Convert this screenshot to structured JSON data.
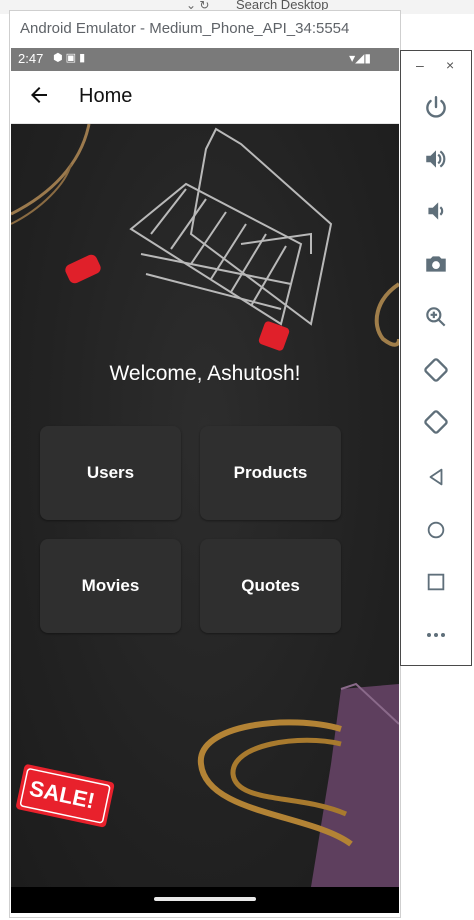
{
  "desktop": {
    "search_text": "Search Desktop",
    "icons": "⌄ ↻"
  },
  "emulator": {
    "title": "Android Emulator - Medium_Phone_API_34:5554"
  },
  "status_bar": {
    "time": "2:47",
    "left_icons": "⬢ ▣ ▮",
    "right_icons": "▾◢▮"
  },
  "app_bar": {
    "title": "Home"
  },
  "main": {
    "welcome": "Welcome, Ashutosh!",
    "tiles": [
      {
        "label": "Users"
      },
      {
        "label": "Products"
      },
      {
        "label": "Movies"
      },
      {
        "label": "Quotes"
      }
    ],
    "sale_tag": "SALE!"
  },
  "toolbar": {
    "minimize": "–",
    "close": "×",
    "buttons": [
      "power-icon",
      "volume-up-icon",
      "volume-down-icon",
      "camera-icon",
      "zoom-icon",
      "rotate-left-icon",
      "rotate-right-icon",
      "back-icon",
      "home-icon",
      "overview-icon",
      "more-icon"
    ]
  },
  "colors": {
    "toolbar_icon": "#5f6f7a",
    "status_bar": "#7a7a7a",
    "tile_bg": "#2f2f2f",
    "background": "#222222"
  }
}
